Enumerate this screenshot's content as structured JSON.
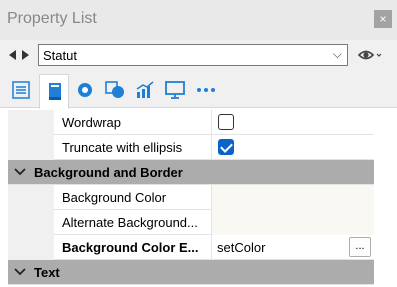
{
  "window": {
    "title": "Property List",
    "close_label": "×"
  },
  "selector": {
    "value": "Statut",
    "chevron": "⌵"
  },
  "toolbar": {
    "icons": [
      "list-icon",
      "page-icon",
      "gear-icon",
      "shapes-icon",
      "chart-icon",
      "monitor-icon",
      "more-icon"
    ],
    "accent": "#1e7fd6"
  },
  "rows": [
    {
      "name": "Wordwrap",
      "type": "checkbox",
      "checked": false
    },
    {
      "name": "Truncate with ellipsis",
      "type": "checkbox",
      "checked": true
    }
  ],
  "categories": [
    {
      "label": "Background and Border",
      "rows": [
        {
          "name": "Background Color",
          "value": ""
        },
        {
          "name": "Alternate Background...",
          "value": ""
        },
        {
          "name": "Background Color E...",
          "value": "setColor",
          "button": "..."
        }
      ]
    },
    {
      "label": "Text"
    }
  ],
  "colors": {
    "category_bg": "#acacac",
    "checkbox_checked": "#0a64c8"
  }
}
